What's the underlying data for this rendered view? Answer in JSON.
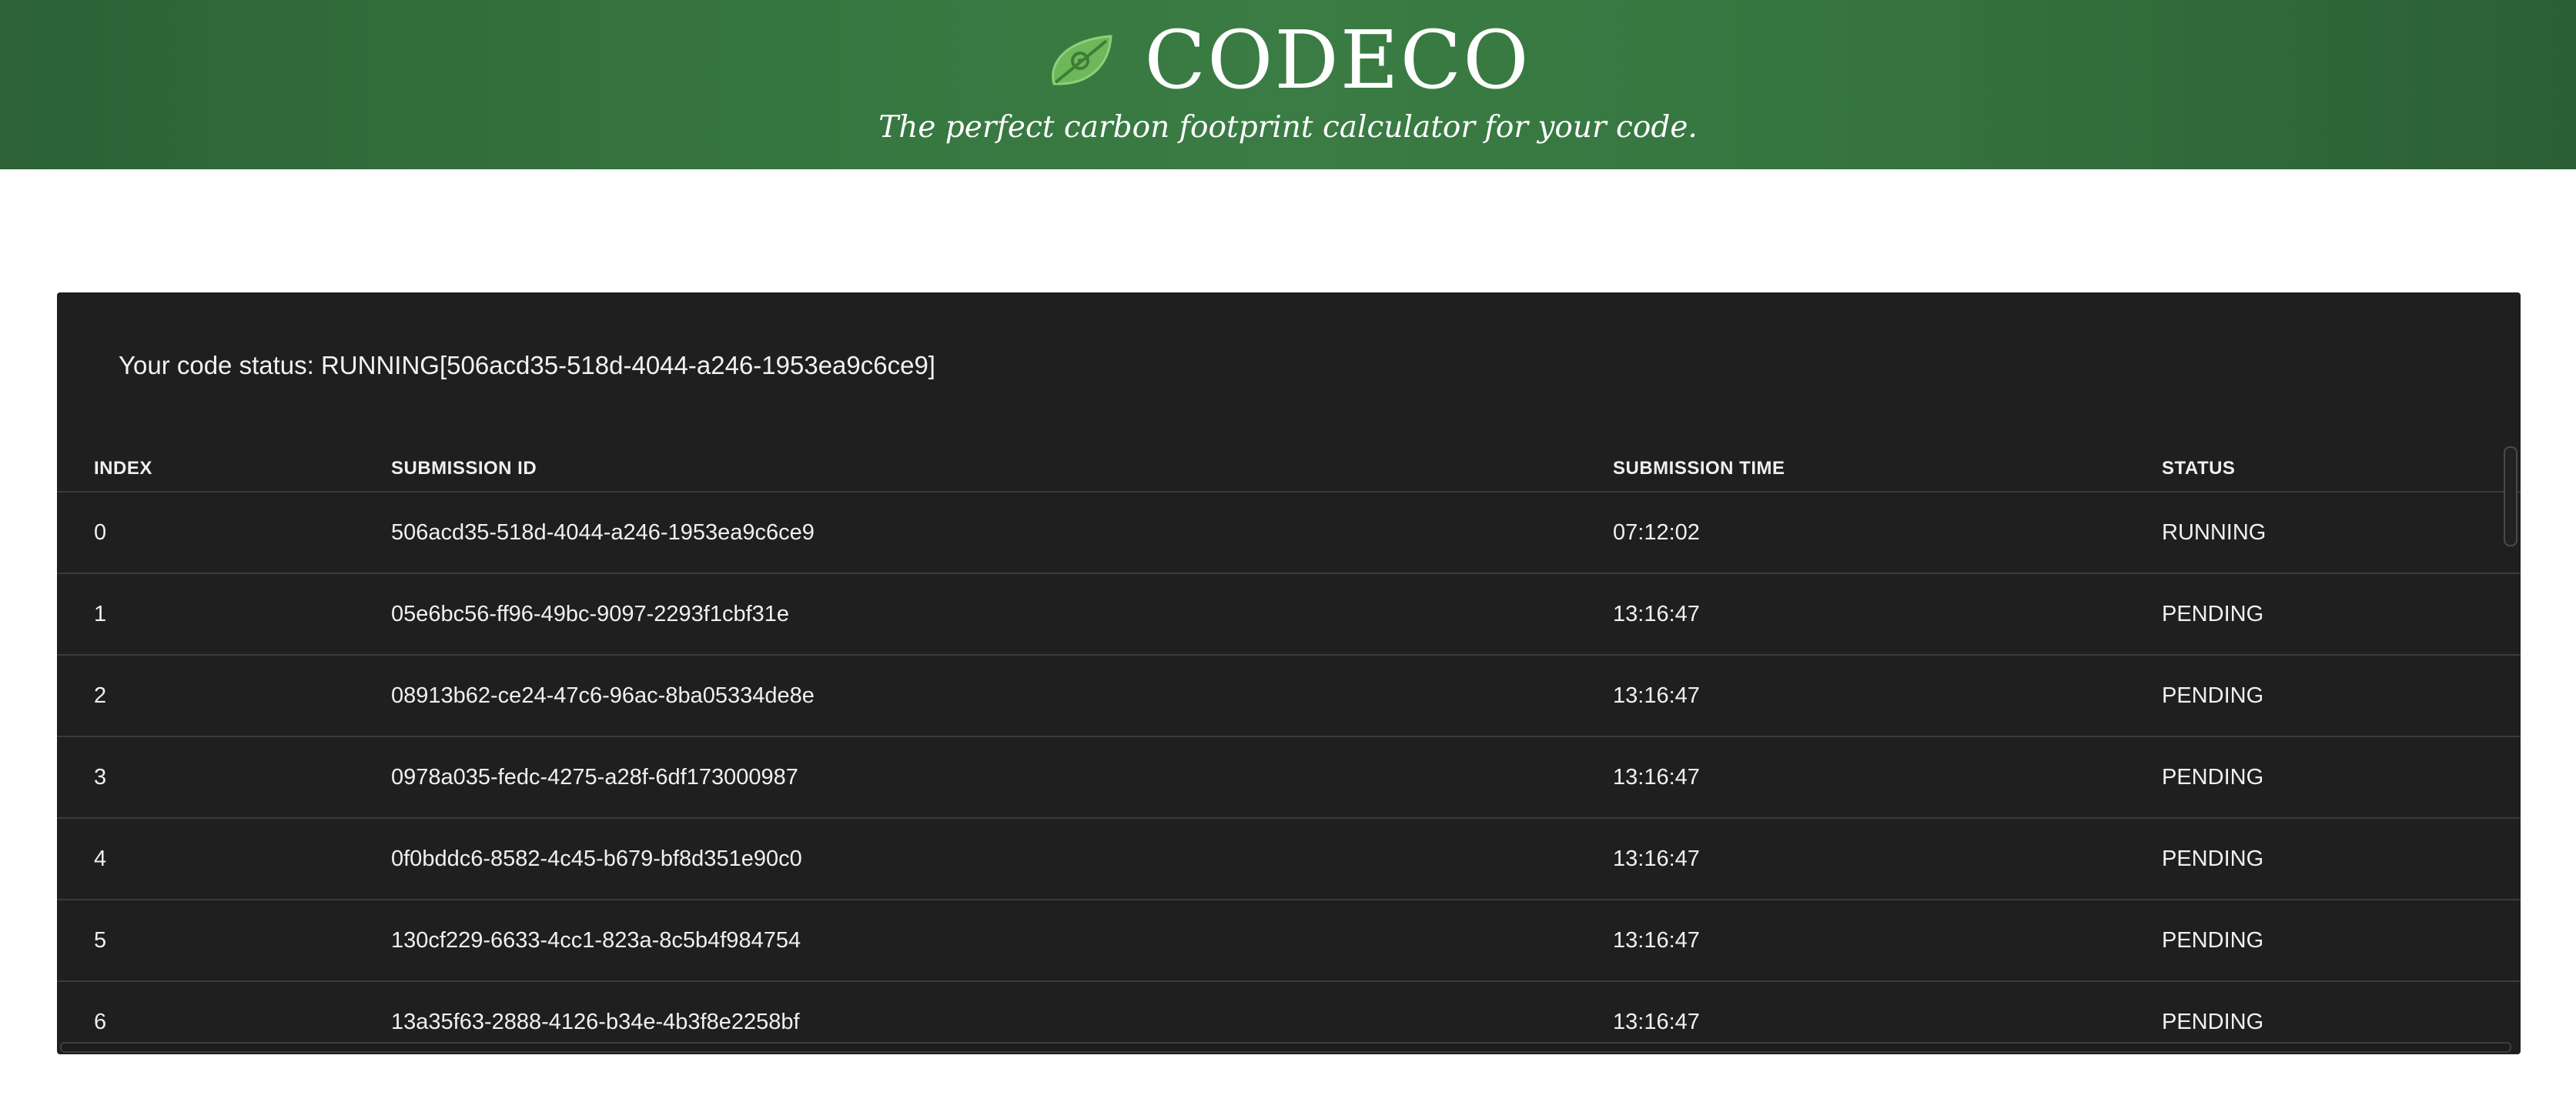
{
  "header": {
    "title": "CODECO",
    "subtitle": "The perfect carbon footprint calculator for your code.",
    "logo_icon": "leaf-icon",
    "background_color": "#367640"
  },
  "status": {
    "text": "Your code status: RUNNING[506acd35-518d-4044-a246-1953ea9c6ce9]"
  },
  "table": {
    "columns": {
      "index": "INDEX",
      "submission_id": "SUBMISSION ID",
      "submission_time": "SUBMISSION TIME",
      "status": "STATUS"
    },
    "rows": [
      {
        "index": "0",
        "submission_id": "506acd35-518d-4044-a246-1953ea9c6ce9",
        "submission_time": "07:12:02",
        "status": "RUNNING"
      },
      {
        "index": "1",
        "submission_id": "05e6bc56-ff96-49bc-9097-2293f1cbf31e",
        "submission_time": "13:16:47",
        "status": "PENDING"
      },
      {
        "index": "2",
        "submission_id": "08913b62-ce24-47c6-96ac-8ba05334de8e",
        "submission_time": "13:16:47",
        "status": "PENDING"
      },
      {
        "index": "3",
        "submission_id": "0978a035-fedc-4275-a28f-6df173000987",
        "submission_time": "13:16:47",
        "status": "PENDING"
      },
      {
        "index": "4",
        "submission_id": "0f0bddc6-8582-4c45-b679-bf8d351e90c0",
        "submission_time": "13:16:47",
        "status": "PENDING"
      },
      {
        "index": "5",
        "submission_id": "130cf229-6633-4cc1-823a-8c5b4f984754",
        "submission_time": "13:16:47",
        "status": "PENDING"
      },
      {
        "index": "6",
        "submission_id": "13a35f63-2888-4126-b34e-4b3f8e2258bf",
        "submission_time": "13:16:47",
        "status": "PENDING"
      }
    ]
  },
  "colors": {
    "panel_background": "#1f1f1f",
    "row_divider": "#3a3a3a",
    "text": "#f0f0f0"
  }
}
